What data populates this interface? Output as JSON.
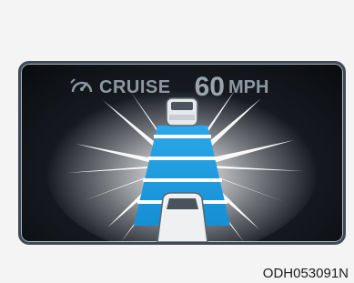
{
  "cruise": {
    "label": "CRUISE",
    "speed": "60",
    "unit": "MPH",
    "icon": "cruise-speedometer-icon"
  },
  "figure_code": "ODH053091N",
  "colors": {
    "lane": "#1e9ce0",
    "panel": "#161a20",
    "frame": "#3f4a55",
    "glow": "#ffffff",
    "text": "#8e98a2"
  },
  "vehicles": [
    "vehicle-ahead",
    "own-vehicle"
  ]
}
